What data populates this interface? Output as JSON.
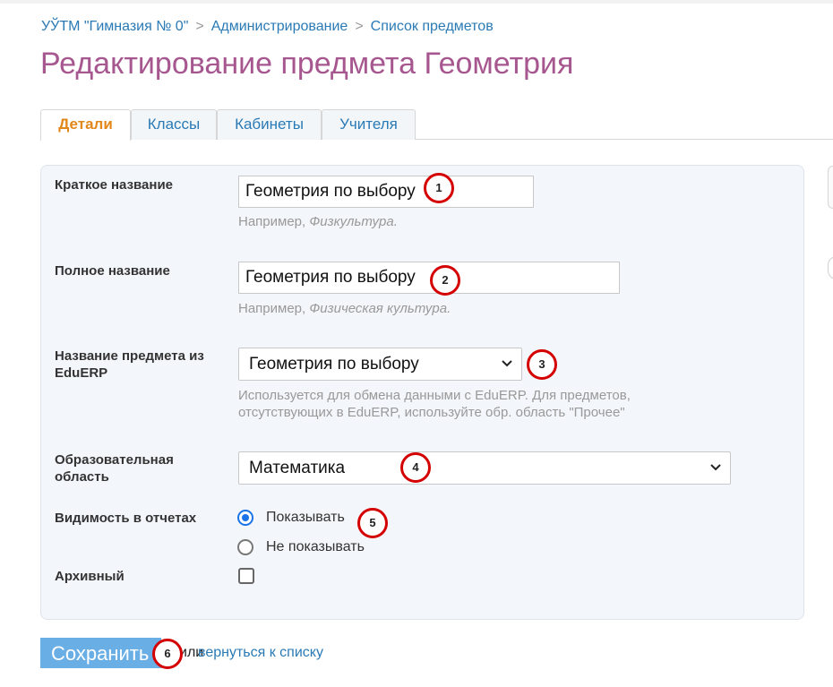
{
  "breadcrumb": {
    "items": [
      "УЎТМ \"Гимназия № 0\"",
      "Администрирование",
      "Список предметов"
    ],
    "separator": ">"
  },
  "page": {
    "title": "Редактирование предмета Геометрия"
  },
  "tabs": [
    {
      "label": "Детали",
      "active": true
    },
    {
      "label": "Классы",
      "active": false
    },
    {
      "label": "Кабинеты",
      "active": false
    },
    {
      "label": "Учителя",
      "active": false
    }
  ],
  "form": {
    "short_name": {
      "label": "Краткое название",
      "value": "Геометрия по выбору",
      "hint_prefix": "Например, ",
      "hint_example": "Физкультура."
    },
    "full_name": {
      "label": "Полное название",
      "value": "Геометрия по выбору",
      "hint_prefix": "Например, ",
      "hint_example": "Физическая культура."
    },
    "eduerp_name": {
      "label_line1": "Название предмета из",
      "label_line2": "EduERP",
      "value": "Геометрия по выбору",
      "hint_line1": "Используется для обмена данными с EduERP. Для предметов,",
      "hint_line2": "отсутствующих в EduERP, используйте обр. область \"Прочее\""
    },
    "education_area": {
      "label_line1": "Образовательная",
      "label_line2": "область",
      "value": "Математика"
    },
    "visibility": {
      "label": "Видимость в отчетах",
      "options": [
        {
          "label": "Показывать",
          "checked": true
        },
        {
          "label": "Не показывать",
          "checked": false
        }
      ]
    },
    "archived": {
      "label": "Архивный",
      "checked": false
    }
  },
  "actions": {
    "save_label": "Сохранить",
    "or_text": "или",
    "back_link": "вернуться к списку"
  },
  "markers": [
    "1",
    "2",
    "3",
    "4",
    "5",
    "6"
  ],
  "colors": {
    "title": "#a7578f",
    "link": "#2a7ab5",
    "active_tab": "#e2871a",
    "save_button": "#6aaee6",
    "marker_ring": "#d40000",
    "radio_checked": "#1a73e8",
    "panel_bg": "#f3f6fa"
  }
}
